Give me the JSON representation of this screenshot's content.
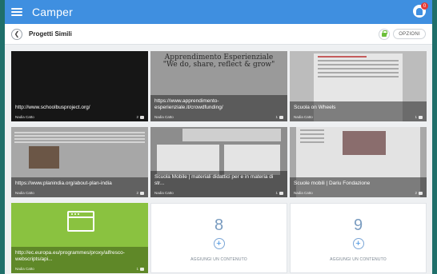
{
  "app": {
    "title": "Camper",
    "notification_count": "0"
  },
  "subheader": {
    "title": "Progetti Simili",
    "options_label": "OPZIONI"
  },
  "cards": [
    {
      "title": "http://www.schoolbusproject.org/",
      "author": "Nadia Catto",
      "comments": "2"
    },
    {
      "title": "https://www.apprendimento-esperienziale.it/crowdfunding/",
      "author": "Nadia Catto",
      "comments": "1",
      "banner_line1": "Apprendimento Esperienziale",
      "banner_line2": "\"We do, share, reflect & grow\""
    },
    {
      "title": "Scuola on Wheels",
      "author": "Nadia Catto",
      "comments": "1"
    },
    {
      "title": "https://www.planindia.org/about-plan-india",
      "author": "Nadia Catto",
      "comments": "2"
    },
    {
      "title": "Scuola Mobile | materiali didattici per e in materia di str...",
      "author": "Nadia Catto",
      "comments": "1"
    },
    {
      "title": "Scuole mobili | Dariu Fondazione",
      "author": "Nadia Catto",
      "comments": "2"
    },
    {
      "title": "http://ec.europa.eu/programmes/proxy/alfresco-webscripts/api...",
      "author": "Nadia Catto",
      "comments": "1"
    }
  ],
  "slots": [
    {
      "number": "8",
      "label": "AGGIUNGI UN CONTENUTO"
    },
    {
      "number": "9",
      "label": "AGGIUNGI UN CONTENUTO"
    }
  ],
  "colors": {
    "appbar": "#3f8fe0",
    "green_card": "#8ac240",
    "background": "#1f6f6a"
  }
}
